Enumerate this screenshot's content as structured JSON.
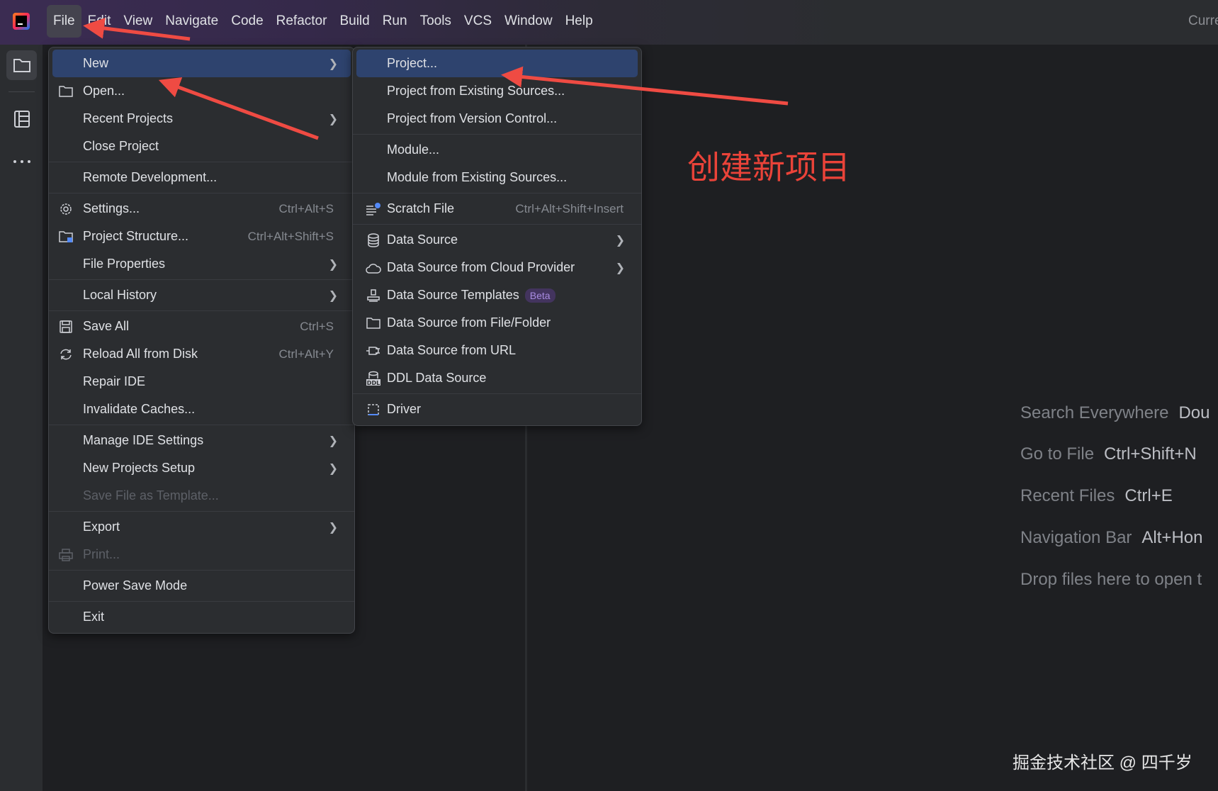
{
  "menubar": {
    "items": [
      "File",
      "Edit",
      "View",
      "Navigate",
      "Code",
      "Refactor",
      "Build",
      "Run",
      "Tools",
      "VCS",
      "Window",
      "Help"
    ],
    "right_text": "Curre"
  },
  "file_menu": [
    {
      "label": "New",
      "icon": "",
      "submenu": true,
      "selected": true
    },
    {
      "label": "Open...",
      "icon": "folder"
    },
    {
      "label": "Recent Projects",
      "submenu": true
    },
    {
      "label": "Close Project"
    },
    {
      "sep": true
    },
    {
      "label": "Remote Development..."
    },
    {
      "sep": true
    },
    {
      "label": "Settings...",
      "icon": "gear",
      "shortcut": "Ctrl+Alt+S"
    },
    {
      "label": "Project Structure...",
      "icon": "project-structure",
      "shortcut": "Ctrl+Alt+Shift+S"
    },
    {
      "label": "File Properties",
      "submenu": true
    },
    {
      "sep": true
    },
    {
      "label": "Local History",
      "submenu": true
    },
    {
      "sep": true
    },
    {
      "label": "Save All",
      "icon": "save",
      "shortcut": "Ctrl+S"
    },
    {
      "label": "Reload All from Disk",
      "icon": "reload",
      "shortcut": "Ctrl+Alt+Y"
    },
    {
      "label": "Repair IDE"
    },
    {
      "label": "Invalidate Caches..."
    },
    {
      "sep": true
    },
    {
      "label": "Manage IDE Settings",
      "submenu": true
    },
    {
      "label": "New Projects Setup",
      "submenu": true
    },
    {
      "label": "Save File as Template...",
      "disabled": true
    },
    {
      "sep": true
    },
    {
      "label": "Export",
      "submenu": true
    },
    {
      "label": "Print...",
      "icon": "print",
      "disabled": true
    },
    {
      "sep": true
    },
    {
      "label": "Power Save Mode"
    },
    {
      "sep": true
    },
    {
      "label": "Exit"
    }
  ],
  "new_submenu": [
    {
      "label": "Project...",
      "selected": true
    },
    {
      "label": "Project from Existing Sources..."
    },
    {
      "label": "Project from Version Control..."
    },
    {
      "sep": true
    },
    {
      "label": "Module..."
    },
    {
      "label": "Module from Existing Sources..."
    },
    {
      "sep": true
    },
    {
      "label": "Scratch File",
      "icon": "scratch",
      "shortcut": "Ctrl+Alt+Shift+Insert"
    },
    {
      "sep": true
    },
    {
      "label": "Data Source",
      "icon": "database",
      "submenu": true
    },
    {
      "label": "Data Source from Cloud Provider",
      "icon": "cloud",
      "submenu": true
    },
    {
      "label": "Data Source Templates",
      "icon": "stamp",
      "badge": "Beta"
    },
    {
      "label": "Data Source from File/Folder",
      "icon": "folder"
    },
    {
      "label": "Data Source from URL",
      "icon": "plug"
    },
    {
      "label": "DDL Data Source",
      "icon": "ddl"
    },
    {
      "sep": true
    },
    {
      "label": "Driver",
      "icon": "driver"
    }
  ],
  "hints": [
    {
      "label": "Search Everywhere",
      "shortcut": "Dou"
    },
    {
      "label": "Go to File",
      "shortcut": "Ctrl+Shift+N"
    },
    {
      "label": "Recent Files",
      "shortcut": "Ctrl+E"
    },
    {
      "label": "Navigation Bar",
      "shortcut": "Alt+Hon"
    },
    {
      "label": "Drop files here to open t",
      "shortcut": ""
    }
  ],
  "annotation": "创建新项目",
  "watermark": "掘金技术社区 @ 四千岁",
  "colors": {
    "accent": "#2e436e",
    "annotation": "#ea4339"
  }
}
